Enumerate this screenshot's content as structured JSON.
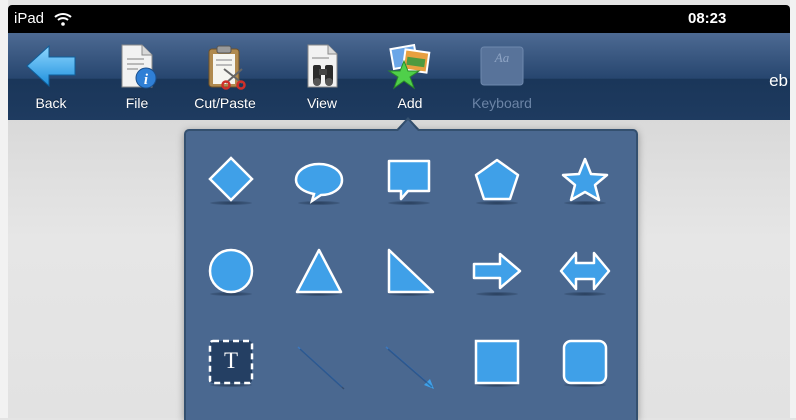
{
  "status_bar": {
    "device": "iPad",
    "time": "08:23",
    "wifi_icon": "wifi-icon"
  },
  "toolbar": {
    "items": [
      {
        "label": "Back",
        "icon": "back-arrow-icon",
        "enabled": true
      },
      {
        "label": "File",
        "icon": "file-info-icon",
        "enabled": true
      },
      {
        "label": "Cut/Paste",
        "icon": "clipboard-scissors-icon",
        "enabled": true
      },
      {
        "label": "View",
        "icon": "binoculars-document-icon",
        "enabled": true
      },
      {
        "label": "Add",
        "icon": "add-pictures-star-icon",
        "enabled": true
      },
      {
        "label": "Keyboard",
        "icon": "keyboard-aa-icon",
        "enabled": false
      }
    ],
    "title_fragment": "eb"
  },
  "add_popover": {
    "shapes": [
      "diamond-icon",
      "speech-bubble-round-icon",
      "speech-bubble-rect-icon",
      "pentagon-icon",
      "star-icon",
      "circle-icon",
      "triangle-icon",
      "right-triangle-icon",
      "arrow-right-icon",
      "double-arrow-icon",
      "text-box-icon",
      "line-icon",
      "arrow-line-icon",
      "square-icon",
      "rounded-square-icon"
    ],
    "text_box_glyph": "T"
  },
  "colors": {
    "toolbar_top": "#4d6a93",
    "toolbar_bottom": "#1e3b60",
    "popover_bg": "#4a6890",
    "shape_fill": "#3fa0e8",
    "shape_stroke": "#ffffff"
  }
}
